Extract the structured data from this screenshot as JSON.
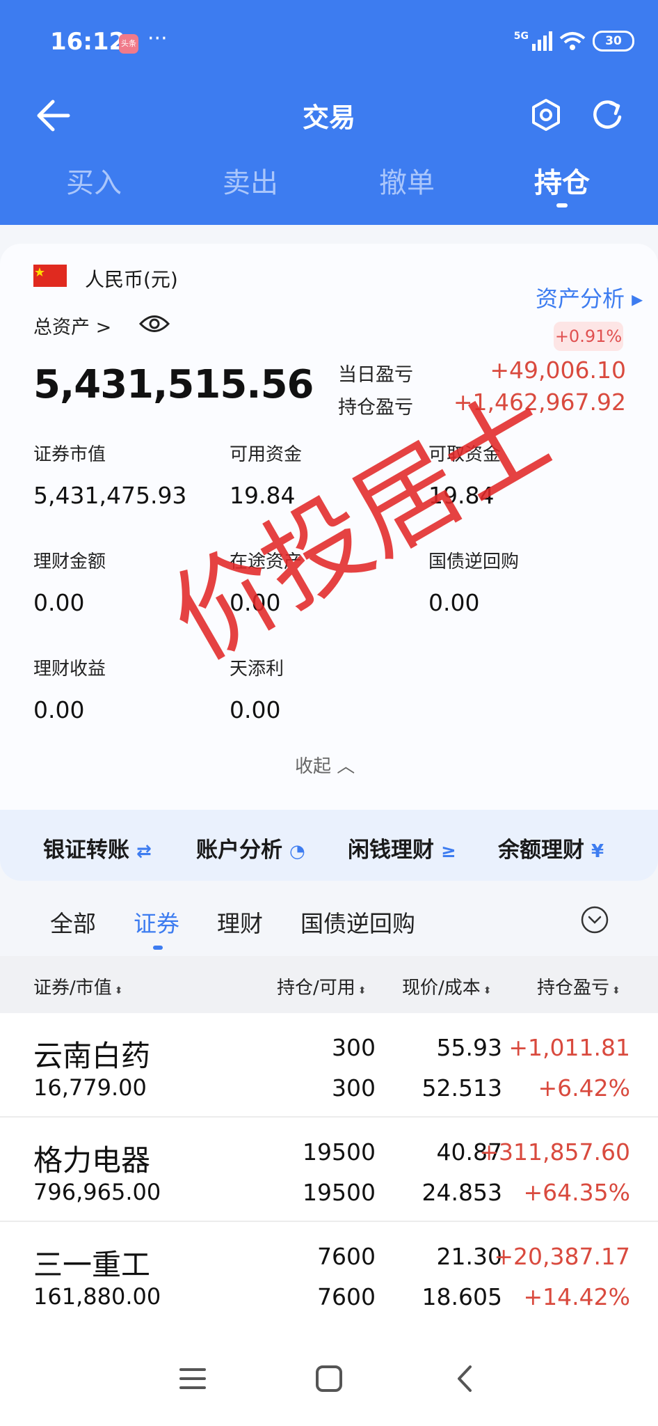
{
  "status_bar": {
    "time": "16:12",
    "app_badge": "头条",
    "more": "···",
    "network": "5G",
    "battery": "30"
  },
  "header": {
    "title": "交易",
    "tabs": [
      {
        "label": "买入"
      },
      {
        "label": "卖出"
      },
      {
        "label": "撤单"
      },
      {
        "label": "持仓"
      }
    ],
    "active_tab": "持仓",
    "colors": {
      "brand": "#3d7cf0",
      "loss_gain_red": "#d94a3e"
    }
  },
  "asset": {
    "currency": "人民币(元)",
    "analysis_link": "资产分析 ▸",
    "total_label": "总资产 >",
    "total_value": "5,431,515.56",
    "change_pct": "+0.91%",
    "daily_pl_label": "当日盈亏",
    "daily_pl_value": "+49,006.10",
    "position_pl_label": "持仓盈亏",
    "position_pl_value": "+1,462,967.92",
    "grid": [
      {
        "label": "证券市值",
        "value": "5,431,475.93"
      },
      {
        "label": "可用资金",
        "value": "19.84"
      },
      {
        "label": "可取资金",
        "value": "19.84"
      },
      {
        "label": "理财金额",
        "value": "0.00"
      },
      {
        "label": "在途资产",
        "value": "0.00"
      },
      {
        "label": "国债逆回购",
        "value": "0.00"
      },
      {
        "label": "理财收益",
        "value": "0.00"
      },
      {
        "label": "天添利",
        "value": "0.00"
      }
    ],
    "collapse_label": "收起 ︿"
  },
  "quick_actions": [
    {
      "label": "银证转账",
      "icon": "⇄"
    },
    {
      "label": "账户分析",
      "icon": "◔"
    },
    {
      "label": "闲钱理财",
      "icon": "≥"
    },
    {
      "label": "余额理财",
      "icon": "¥"
    }
  ],
  "list_tabs": [
    {
      "label": "全部"
    },
    {
      "label": "证券"
    },
    {
      "label": "理财"
    },
    {
      "label": "国债逆回购"
    }
  ],
  "table": {
    "headers": [
      "证券/市值",
      "持仓/可用",
      "现价/成本",
      "持仓盈亏"
    ],
    "sort_icon": "⬍",
    "rows": [
      {
        "name": "云南白药",
        "market_value": "16,779.00",
        "position": "300",
        "available": "300",
        "price": "55.93",
        "cost": "52.513",
        "pl": "+1,011.81",
        "pl_pct": "+6.42%"
      },
      {
        "name": "格力电器",
        "market_value": "796,965.00",
        "position": "19500",
        "available": "19500",
        "price": "40.87",
        "cost": "24.853",
        "pl": "+311,857.60",
        "pl_pct": "+64.35%"
      },
      {
        "name": "三一重工",
        "market_value": "161,880.00",
        "position": "7600",
        "available": "7600",
        "price": "21.30",
        "cost": "18.605",
        "pl": "+20,387.17",
        "pl_pct": "+14.42%"
      }
    ]
  },
  "watermark": "价投居士"
}
